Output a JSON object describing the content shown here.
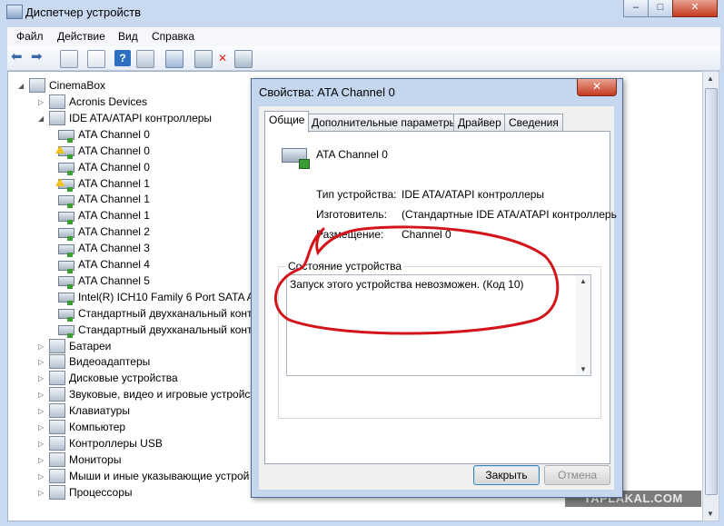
{
  "window": {
    "title": "Диспетчер устройств"
  },
  "menu": [
    "Файл",
    "Действие",
    "Вид",
    "Справка"
  ],
  "tree": {
    "root": "CinemaBox",
    "items": [
      "Acronis Devices",
      "IDE ATA/ATAPI контроллеры",
      "ATA Channel 0",
      "ATA Channel 0",
      "ATA Channel 0",
      "ATA Channel 1",
      "ATA Channel 1",
      "ATA Channel 1",
      "ATA Channel 2",
      "ATA Channel 3",
      "ATA Channel 4",
      "ATA Channel 5",
      "Intel(R) ICH10 Family 6 Port SATA A",
      "Стандартный двухканальный конт",
      "Стандартный двухканальный конт",
      "Батареи",
      "Видеоадаптеры",
      "Дисковые устройства",
      "Звуковые, видео и игровые устройст",
      "Клавиатуры",
      "Компьютер",
      "Контроллеры USB",
      "Мониторы",
      "Мыши и иные указывающие устрой",
      "Процессоры"
    ]
  },
  "dialog": {
    "title": "Свойства: ATA Channel 0",
    "close": "✕",
    "tabs": [
      "Общие",
      "Дополнительные параметры",
      "Драйвер",
      "Сведения"
    ],
    "device_name": "ATA Channel 0",
    "fields": {
      "type_label": "Тип устройства:",
      "type_value": "IDE ATA/ATAPI контроллеры",
      "maker_label": "Изготовитель:",
      "maker_value": "(Стандартные IDE ATA/ATAPI контроллерь",
      "location_label": "Размещение:",
      "location_value": "Channel 0"
    },
    "status_group": "Состояние устройства",
    "status_text": "Запуск этого устройства невозможен. (Код 10)",
    "ok": "Закрыть",
    "cancel": "Отмена"
  },
  "watermark": "YAPLAKAL.COM",
  "colors": {
    "annotation": "#d4141b",
    "warning": "#f2c21a"
  }
}
